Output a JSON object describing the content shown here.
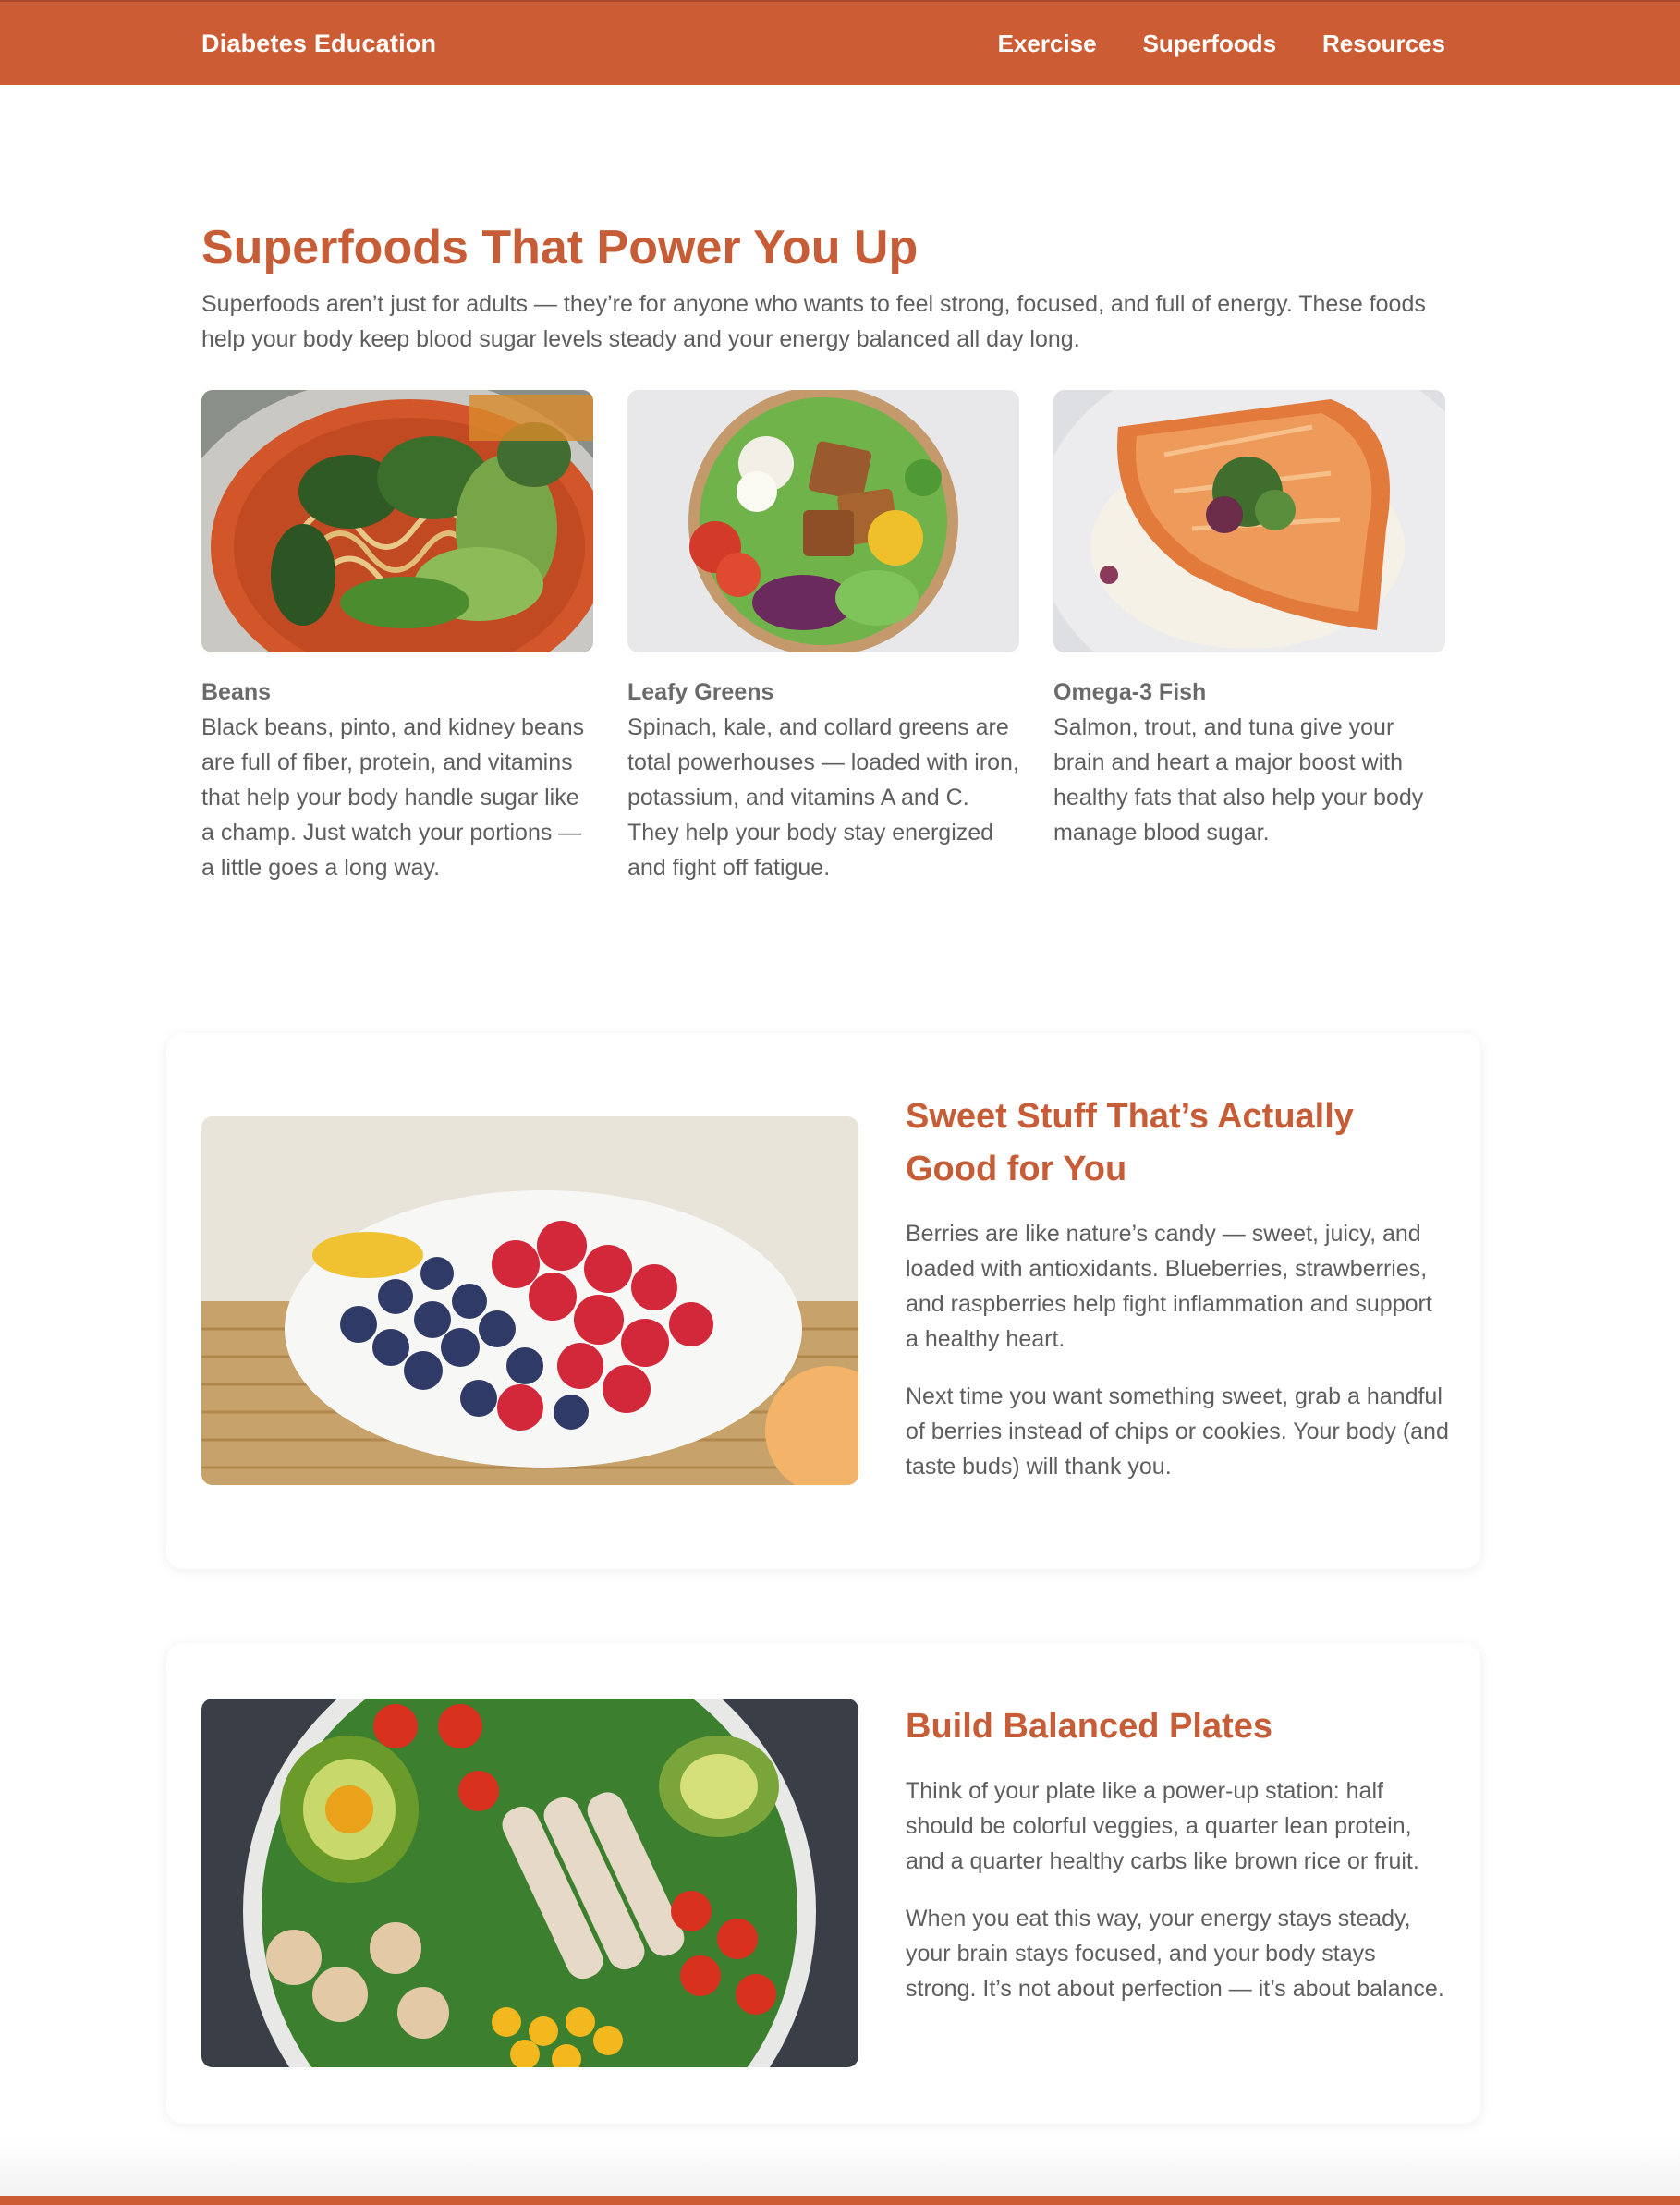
{
  "navbar": {
    "brand": "Diabetes Education",
    "links": [
      {
        "label": "Exercise"
      },
      {
        "label": "Superfoods"
      },
      {
        "label": "Resources"
      }
    ]
  },
  "hero": {
    "title": "Superfoods That Power You Up",
    "intro": "Superfoods aren’t just for adults — they’re for anyone who wants to feel strong, focused, and full of energy. These foods help your body keep blood sugar levels steady and your energy balanced all day long."
  },
  "cards": [
    {
      "title": "Beans",
      "text": "Black beans, pinto, and kidney beans are full of fiber, protein, and vitamins that help your body handle sugar like a champ. Just watch your portions — a little goes a long way."
    },
    {
      "title": "Leafy Greens",
      "text": "Spinach, kale, and collard greens are total powerhouses — loaded with iron, potassium, and vitamins A and C. They help your body stay energized and fight off fatigue."
    },
    {
      "title": "Omega-3 Fish",
      "text": "Salmon, trout, and tuna give your brain and heart a major boost with healthy fats that also help your body manage blood sugar."
    }
  ],
  "features": [
    {
      "title": "Sweet Stuff That’s Actually Good for You",
      "paragraphs": [
        "Berries are like nature’s candy — sweet, juicy, and loaded with antioxidants. Blueberries, strawberries, and raspberries help fight inflammation and support a healthy heart.",
        "Next time you want something sweet, grab a handful of berries instead of chips or cookies. Your body (and taste buds) will thank you."
      ]
    },
    {
      "title": "Build Balanced Plates",
      "paragraphs": [
        "Think of your plate like a power-up station: half should be colorful veggies, a quarter lean protein, and a quarter healthy carbs like brown rice or fruit.",
        "When you eat this way, your energy stays steady, your brain stays focused, and your body stays strong. It’s not about perfection — it’s about balance."
      ]
    }
  ],
  "colors": {
    "brand": "#cc5c34",
    "heading": "#c65d36",
    "body_text": "#5e5e5e"
  }
}
